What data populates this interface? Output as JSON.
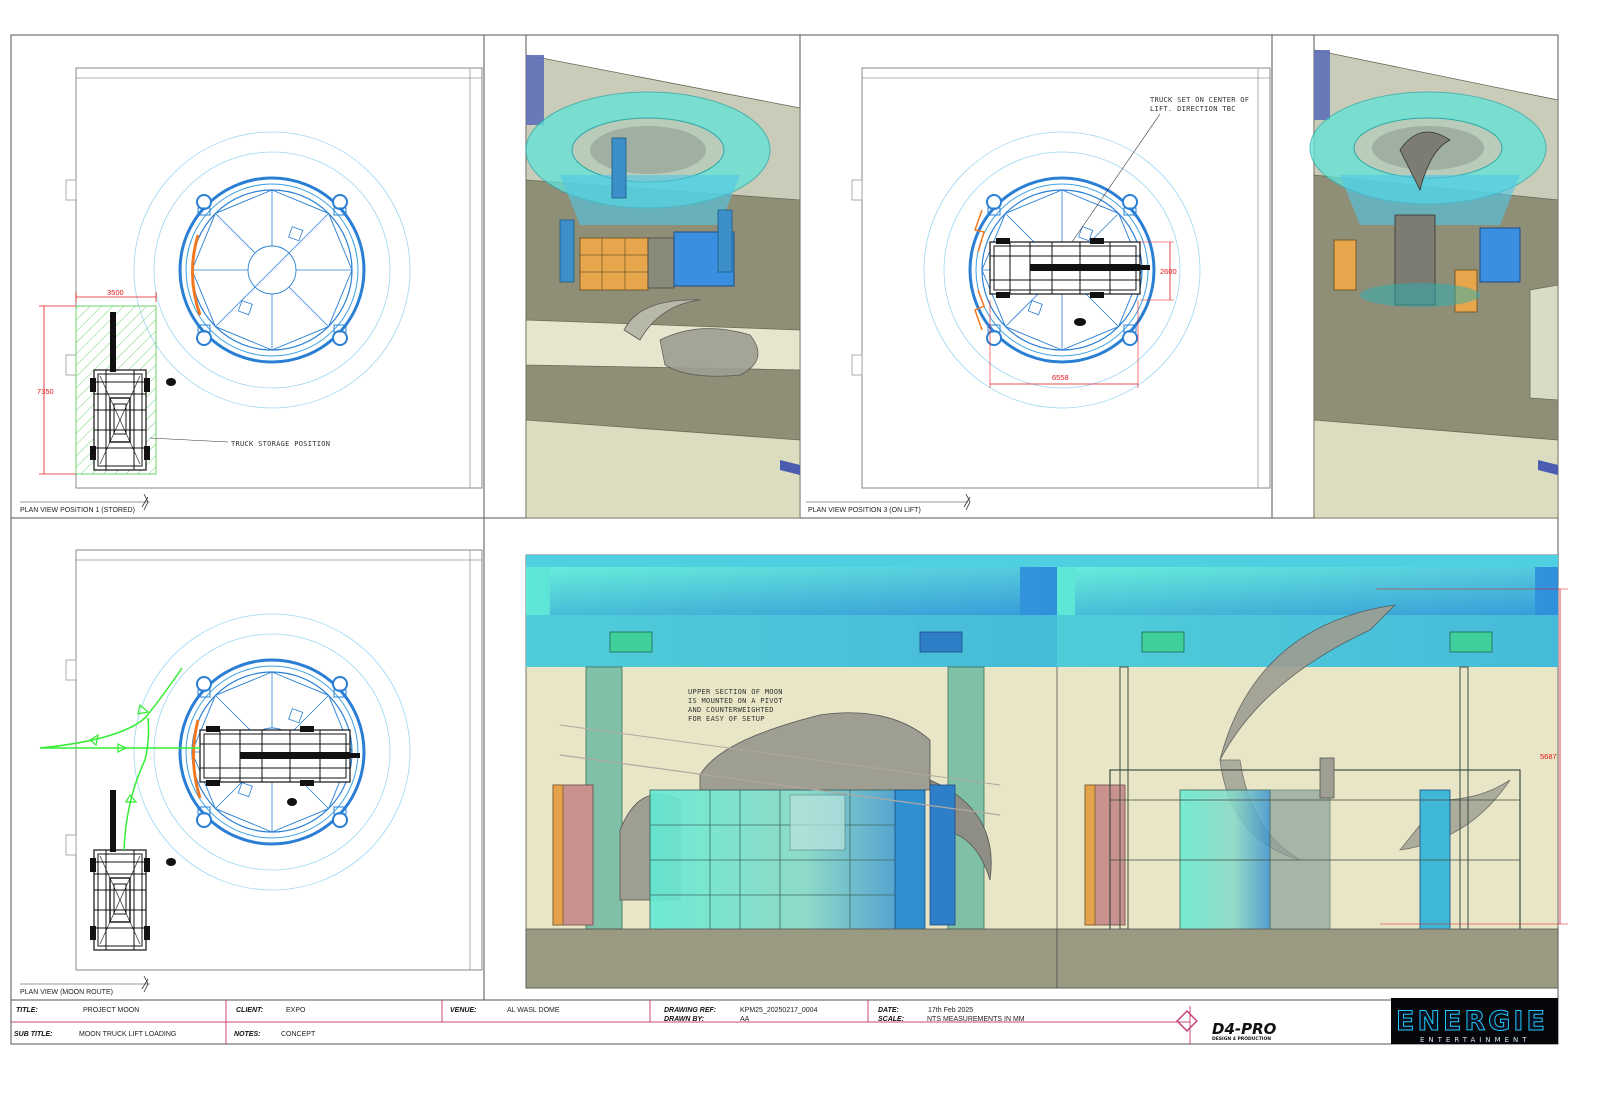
{
  "plans": {
    "p1": {
      "label": "PLAN VIEW POSITION 1 (STORED)",
      "dim_width": "3500",
      "dim_length": "7350",
      "note": "TRUCK STORAGE POSITION"
    },
    "p3": {
      "label": "PLAN VIEW POSITION 3 (ON LIFT)",
      "dim_width": "6558",
      "dim_height": "2600",
      "note_line1": "TRUCK SET ON CENTER OF",
      "note_line2": "LIFT. DIRECTION TBC"
    },
    "route": {
      "label": "PLAN VIEW (MOON ROUTE)"
    }
  },
  "elevation": {
    "note_line1": "UPPER SECTION OF MOON",
    "note_line2": "IS MOUNTED ON A PIVOT",
    "note_line3": "AND COUNTERWEIGHTED",
    "note_line4": "FOR EASY OF SETUP",
    "dim_height": "5687"
  },
  "title_block": {
    "title_key": "TITLE:",
    "title": "PROJECT MOON",
    "subtitle_key": "SUB TITLE:",
    "subtitle": "MOON TRUCK LIFT LOADING",
    "client_key": "CLIENT:",
    "client": "EXPO",
    "notes_key": "NOTES:",
    "notes": "CONCEPT",
    "venue_key": "VENUE:",
    "venue": "AL WASL DOME",
    "drawing_ref_key": "DRAWING REF:",
    "drawing_ref": "KPM25_20250217_0004",
    "drawn_by_key": "DRAWN BY:",
    "drawn_by": "AA",
    "date_key": "DATE:",
    "date": "17th Feb 2025",
    "scale_key": "SCALE:",
    "scale": "NTS MEASUREMENTS IN MM"
  },
  "logos": {
    "design_logo": "D4-PRO",
    "design_logo_sub": "DESIGN 4 PRODUCTION",
    "company_logo": "ENERGIE",
    "company_logo_sub": "ENTERTAINMENT"
  },
  "colors": {
    "accent_red": "#e0191b",
    "lift_blue": "#2a7fd4",
    "cyan_glass": "#5fe3d9",
    "route_green": "#33ee33",
    "pink_line": "#c9447a"
  }
}
